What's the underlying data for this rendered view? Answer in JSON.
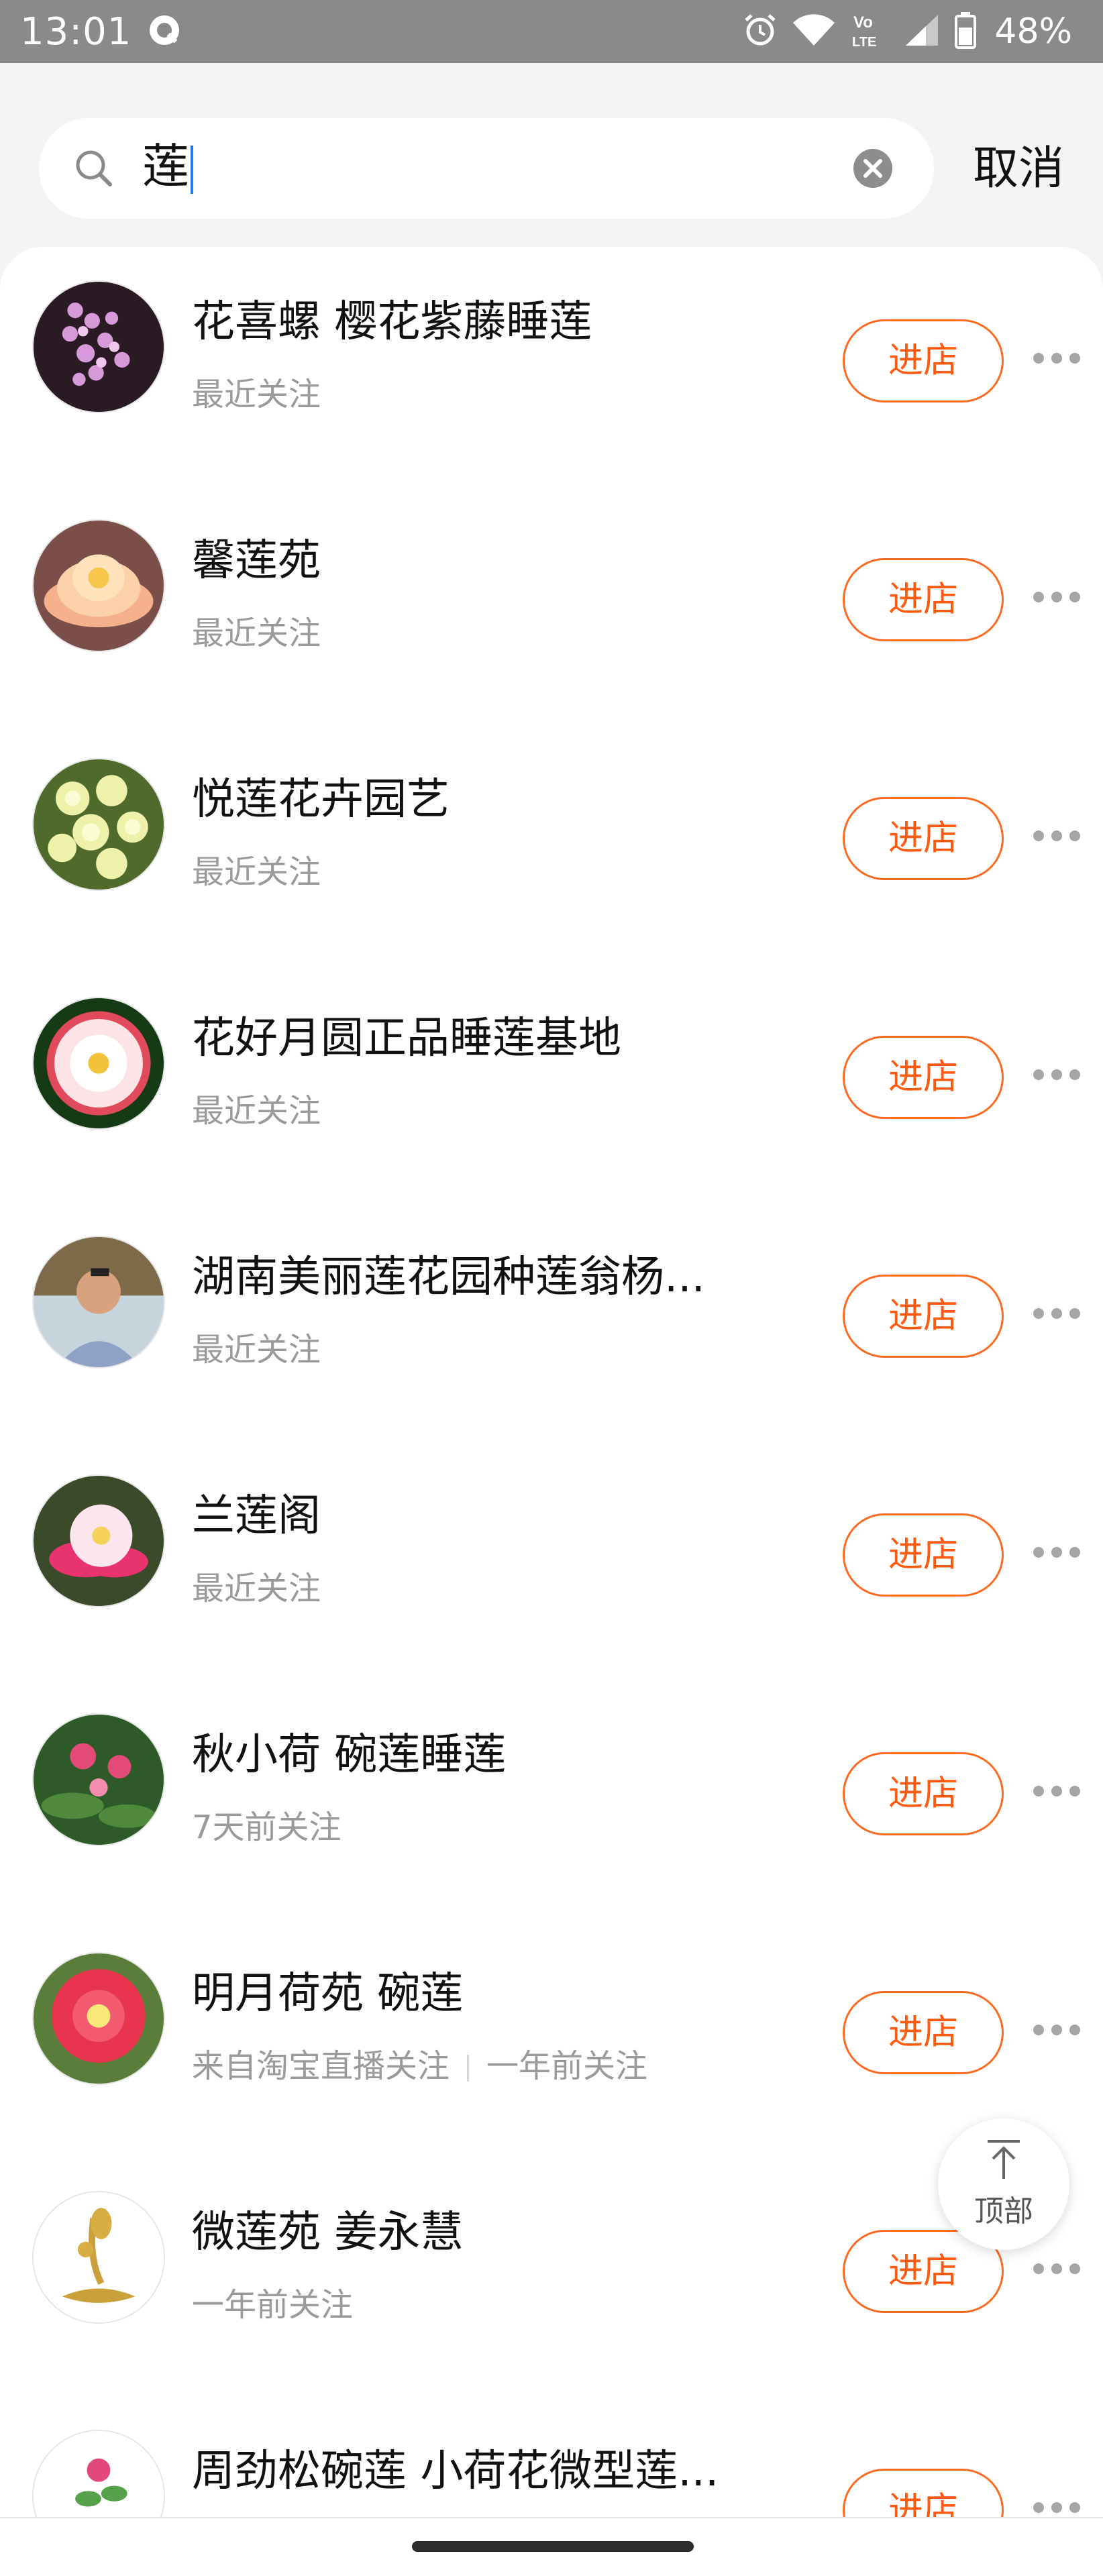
{
  "status_bar": {
    "time": "13:01",
    "battery": "48%",
    "icons": [
      "q-notification-icon",
      "alarm-icon",
      "wifi-icon",
      "volte-icon",
      "signal-icon",
      "battery-icon"
    ]
  },
  "search": {
    "value": "莲",
    "cancel_label": "取消"
  },
  "enter_label": "进店",
  "shops": [
    {
      "name": "花喜螺 樱花紫藤睡莲",
      "follow": "最近关注",
      "avatar": "wisteria"
    },
    {
      "name": "馨莲苑",
      "follow": "最近关注",
      "avatar": "peach-lotus"
    },
    {
      "name": "悦莲花卉园艺",
      "follow": "最近关注",
      "avatar": "yellow-roses"
    },
    {
      "name": "花好月圆正品睡莲基地",
      "follow": "最近关注",
      "avatar": "white-lotus"
    },
    {
      "name": "湖南美丽莲花园种莲翁杨...",
      "follow": "最近关注",
      "avatar": "portrait"
    },
    {
      "name": "兰莲阁",
      "follow": "最近关注",
      "avatar": "pink-lotus"
    },
    {
      "name": "秋小荷 碗莲睡莲",
      "follow": "7天前关注",
      "avatar": "pond"
    },
    {
      "name": "明月荷苑 碗莲",
      "follow": "来自淘宝直播关注",
      "follow_extra": "一年前关注",
      "avatar": "red-lotus"
    },
    {
      "name": "微莲苑 姜永慧",
      "follow": "一年前关注",
      "avatar": "gold-logo"
    },
    {
      "name": "周劲松碗莲 小荷花微型莲...",
      "follow": "",
      "avatar": "lotus-pot"
    }
  ],
  "back_to_top": {
    "label": "顶部"
  },
  "colors": {
    "accent": "#ff5a10",
    "muted_text": "#9a9a9a",
    "status_bar": "#8a8a8a"
  }
}
